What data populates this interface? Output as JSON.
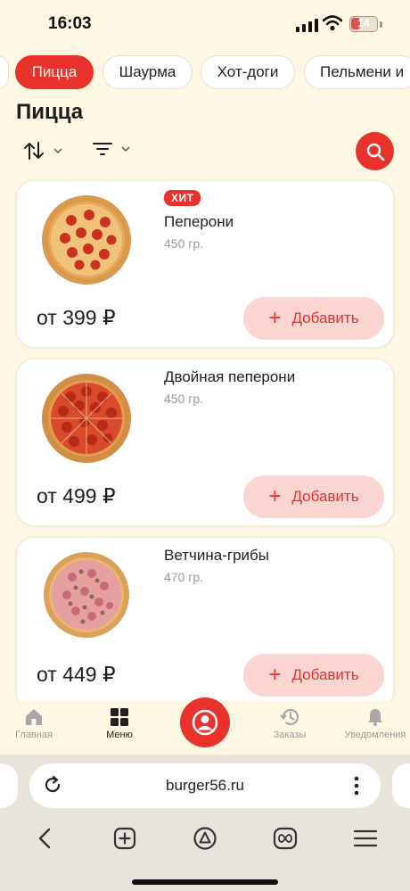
{
  "status_bar": {
    "time": "16:03",
    "battery": "14"
  },
  "categories": [
    "Пицца",
    "Шаурма",
    "Хот-доги",
    "Пельмени и"
  ],
  "page_title": "Пицца",
  "products": [
    {
      "badge": "ХИТ",
      "name": "Пеперони",
      "weight": "450 гр.",
      "price": "от 399 ₽",
      "add_label": "Добавить"
    },
    {
      "badge": "",
      "name": "Двойная пеперони",
      "weight": "450 гр.",
      "price": "от 499 ₽",
      "add_label": "Добавить"
    },
    {
      "badge": "",
      "name": "Ветчина-грибы",
      "weight": "470 гр.",
      "price": "от 449 ₽",
      "add_label": "Добавить"
    }
  ],
  "nav": {
    "home": "Главная",
    "menu": "Меню",
    "orders": "Заказы",
    "notifications": "Уведомления"
  },
  "browser": {
    "url": "burger56.ru"
  },
  "colors": {
    "accent": "#e8322b",
    "add_bg": "#fbd5d2",
    "background": "#fdf7e4"
  },
  "icons": [
    "sort-icon",
    "filter-icon",
    "search-icon",
    "home-icon",
    "menu-grid-icon",
    "profile-icon",
    "history-icon",
    "bell-icon",
    "reload-icon",
    "more-icon",
    "back-icon",
    "new-tab-icon",
    "alice-icon",
    "tabs-icon",
    "hamburger-icon"
  ]
}
